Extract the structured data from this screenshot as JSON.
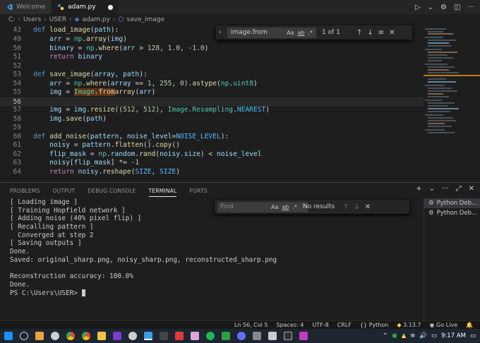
{
  "tabs": [
    {
      "label": "Welcome"
    },
    {
      "label": "adam.py"
    }
  ],
  "breadcrumb": [
    "C:",
    "Users",
    "USER",
    "adam.py",
    "save_image"
  ],
  "editor": {
    "lines": [
      {
        "n": "43",
        "text": "def load_image(path):"
      },
      {
        "n": "49",
        "text": "    arr = np.array(img)"
      },
      {
        "n": "50",
        "text": "    binary = np.where(arr > 128, 1.0, -1.0)"
      },
      {
        "n": "51",
        "text": "    return binary"
      },
      {
        "n": "52",
        "text": ""
      },
      {
        "n": "53",
        "text": "def save_image(array, path):"
      },
      {
        "n": "54",
        "text": "    arr = np.where(array == 1, 255, 0).astype(np.uint8)"
      },
      {
        "n": "55",
        "text": "    img = Image.fromarray(arr)"
      },
      {
        "n": "56",
        "text": ""
      },
      {
        "n": "57",
        "text": "    img = img.resize((512, 512), Image.Resampling.NEAREST)"
      },
      {
        "n": "58",
        "text": "    img.save(path)"
      },
      {
        "n": "59",
        "text": ""
      },
      {
        "n": "60",
        "text": "def add_noise(pattern, noise_level=NOISE_LEVEL):"
      },
      {
        "n": "61",
        "text": "    noisy = pattern.flatten().copy()"
      },
      {
        "n": "62",
        "text": "    flip_mask = np.random.rand(noisy.size) < noise_level"
      },
      {
        "n": "63",
        "text": "    noisy[flip_mask] *= -1"
      },
      {
        "n": "64",
        "text": "    return noisy.reshape(SIZE, SIZE)"
      }
    ]
  },
  "find_editor": {
    "query": "image.from",
    "count": "1 of 1",
    "opt_case": "Aa",
    "opt_word": "ab",
    "opt_regex": ".*"
  },
  "panel": {
    "tabs": [
      "PROBLEMS",
      "OUTPUT",
      "DEBUG CONSOLE",
      "TERMINAL",
      "PORTS"
    ]
  },
  "terminal": {
    "lines": [
      "[ Loading image ]",
      "[ Training Hopfield network ]",
      "[ Adding noise (40% pixel flip) ]",
      "[ Recalling pattern ]",
      "  Converged at step 2",
      "[ Saving outputs ]",
      "Done.",
      "Saved: original_sharp.png, noisy_sharp.png, reconstructed_sharp.png",
      "",
      "Reconstruction accuracy: 100.0%",
      "Done.",
      "PS C:\\Users\\USER> "
    ]
  },
  "find_terminal": {
    "placeholder": "Find",
    "count": "No results",
    "opt_case": "Aa",
    "opt_word": "ab",
    "opt_regex": ".*"
  },
  "term_list": [
    "Python Deb...",
    "Python Deb..."
  ],
  "status": {
    "position": "Ln 56, Col 5",
    "spaces": "Spaces: 4",
    "encoding": "UTF-8",
    "eol": "CRLF",
    "language": "Python",
    "version": "3.13.7",
    "golive": "Go Live"
  },
  "taskbar": {
    "time": "9:17 AM"
  }
}
